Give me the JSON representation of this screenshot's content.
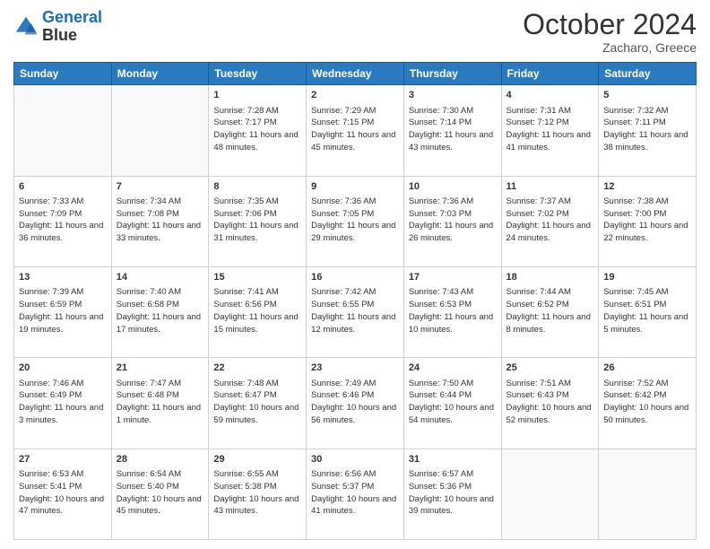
{
  "header": {
    "logo_line1": "General",
    "logo_line2": "Blue",
    "month": "October 2024",
    "location": "Zacharo, Greece"
  },
  "days_of_week": [
    "Sunday",
    "Monday",
    "Tuesday",
    "Wednesday",
    "Thursday",
    "Friday",
    "Saturday"
  ],
  "weeks": [
    [
      {
        "day": "",
        "info": ""
      },
      {
        "day": "",
        "info": ""
      },
      {
        "day": "1",
        "info": "Sunrise: 7:28 AM\nSunset: 7:17 PM\nDaylight: 11 hours and 48 minutes."
      },
      {
        "day": "2",
        "info": "Sunrise: 7:29 AM\nSunset: 7:15 PM\nDaylight: 11 hours and 45 minutes."
      },
      {
        "day": "3",
        "info": "Sunrise: 7:30 AM\nSunset: 7:14 PM\nDaylight: 11 hours and 43 minutes."
      },
      {
        "day": "4",
        "info": "Sunrise: 7:31 AM\nSunset: 7:12 PM\nDaylight: 11 hours and 41 minutes."
      },
      {
        "day": "5",
        "info": "Sunrise: 7:32 AM\nSunset: 7:11 PM\nDaylight: 11 hours and 38 minutes."
      }
    ],
    [
      {
        "day": "6",
        "info": "Sunrise: 7:33 AM\nSunset: 7:09 PM\nDaylight: 11 hours and 36 minutes."
      },
      {
        "day": "7",
        "info": "Sunrise: 7:34 AM\nSunset: 7:08 PM\nDaylight: 11 hours and 33 minutes."
      },
      {
        "day": "8",
        "info": "Sunrise: 7:35 AM\nSunset: 7:06 PM\nDaylight: 11 hours and 31 minutes."
      },
      {
        "day": "9",
        "info": "Sunrise: 7:36 AM\nSunset: 7:05 PM\nDaylight: 11 hours and 29 minutes."
      },
      {
        "day": "10",
        "info": "Sunrise: 7:36 AM\nSunset: 7:03 PM\nDaylight: 11 hours and 26 minutes."
      },
      {
        "day": "11",
        "info": "Sunrise: 7:37 AM\nSunset: 7:02 PM\nDaylight: 11 hours and 24 minutes."
      },
      {
        "day": "12",
        "info": "Sunrise: 7:38 AM\nSunset: 7:00 PM\nDaylight: 11 hours and 22 minutes."
      }
    ],
    [
      {
        "day": "13",
        "info": "Sunrise: 7:39 AM\nSunset: 6:59 PM\nDaylight: 11 hours and 19 minutes."
      },
      {
        "day": "14",
        "info": "Sunrise: 7:40 AM\nSunset: 6:58 PM\nDaylight: 11 hours and 17 minutes."
      },
      {
        "day": "15",
        "info": "Sunrise: 7:41 AM\nSunset: 6:56 PM\nDaylight: 11 hours and 15 minutes."
      },
      {
        "day": "16",
        "info": "Sunrise: 7:42 AM\nSunset: 6:55 PM\nDaylight: 11 hours and 12 minutes."
      },
      {
        "day": "17",
        "info": "Sunrise: 7:43 AM\nSunset: 6:53 PM\nDaylight: 11 hours and 10 minutes."
      },
      {
        "day": "18",
        "info": "Sunrise: 7:44 AM\nSunset: 6:52 PM\nDaylight: 11 hours and 8 minutes."
      },
      {
        "day": "19",
        "info": "Sunrise: 7:45 AM\nSunset: 6:51 PM\nDaylight: 11 hours and 5 minutes."
      }
    ],
    [
      {
        "day": "20",
        "info": "Sunrise: 7:46 AM\nSunset: 6:49 PM\nDaylight: 11 hours and 3 minutes."
      },
      {
        "day": "21",
        "info": "Sunrise: 7:47 AM\nSunset: 6:48 PM\nDaylight: 11 hours and 1 minute."
      },
      {
        "day": "22",
        "info": "Sunrise: 7:48 AM\nSunset: 6:47 PM\nDaylight: 10 hours and 59 minutes."
      },
      {
        "day": "23",
        "info": "Sunrise: 7:49 AM\nSunset: 6:46 PM\nDaylight: 10 hours and 56 minutes."
      },
      {
        "day": "24",
        "info": "Sunrise: 7:50 AM\nSunset: 6:44 PM\nDaylight: 10 hours and 54 minutes."
      },
      {
        "day": "25",
        "info": "Sunrise: 7:51 AM\nSunset: 6:43 PM\nDaylight: 10 hours and 52 minutes."
      },
      {
        "day": "26",
        "info": "Sunrise: 7:52 AM\nSunset: 6:42 PM\nDaylight: 10 hours and 50 minutes."
      }
    ],
    [
      {
        "day": "27",
        "info": "Sunrise: 6:53 AM\nSunset: 5:41 PM\nDaylight: 10 hours and 47 minutes."
      },
      {
        "day": "28",
        "info": "Sunrise: 6:54 AM\nSunset: 5:40 PM\nDaylight: 10 hours and 45 minutes."
      },
      {
        "day": "29",
        "info": "Sunrise: 6:55 AM\nSunset: 5:38 PM\nDaylight: 10 hours and 43 minutes."
      },
      {
        "day": "30",
        "info": "Sunrise: 6:56 AM\nSunset: 5:37 PM\nDaylight: 10 hours and 41 minutes."
      },
      {
        "day": "31",
        "info": "Sunrise: 6:57 AM\nSunset: 5:36 PM\nDaylight: 10 hours and 39 minutes."
      },
      {
        "day": "",
        "info": ""
      },
      {
        "day": "",
        "info": ""
      }
    ]
  ]
}
